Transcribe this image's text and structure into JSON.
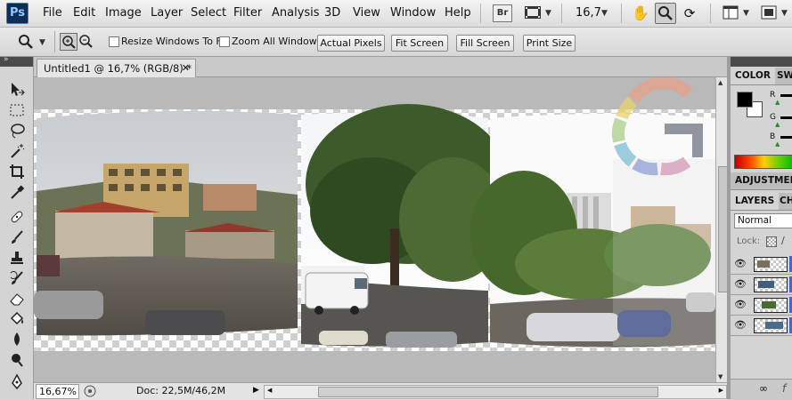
{
  "menubar": {
    "logo": "Ps",
    "items": [
      "File",
      "Edit",
      "Image",
      "Layer",
      "Select",
      "Filter",
      "Analysis",
      "3D",
      "View",
      "Window",
      "Help"
    ],
    "bridge_label": "Br",
    "zoom": "16,7"
  },
  "options": {
    "resize_windows_label": "Resize Windows To Fit",
    "zoom_all_windows_label": "Zoom All Windows",
    "actual_pixels": "Actual Pixels",
    "fit_screen": "Fit Screen",
    "fill_screen": "Fill Screen",
    "print_size": "Print Size"
  },
  "document": {
    "tab_title": "Untitled1 @ 16,7% (RGB/8) *",
    "zoom_status": "16,67%",
    "doc_info": "Doc: 22,5M/46,2M"
  },
  "panels": {
    "color_tab": "COLOR",
    "swatches_tab": "SW",
    "r_label": "R",
    "g_label": "G",
    "b_label": "B",
    "adjustments_tab": "ADJUSTMEN",
    "layers_tab": "LAYERS",
    "channels_tab": "CH",
    "blend_mode": "Normal",
    "lock_label": "Lock:",
    "layer_count": 4
  },
  "colors": {
    "foreground": "#000000",
    "background": "#ffffff",
    "selection": "#3a6ad6"
  },
  "icons": {
    "tools": [
      "move-tool-icon",
      "marquee-tool-icon",
      "lasso-tool-icon",
      "magic-wand-icon",
      "crop-tool-icon",
      "eyedropper-icon",
      "healing-brush-icon",
      "brush-tool-icon",
      "clone-stamp-icon",
      "history-brush-icon",
      "eraser-icon",
      "paint-bucket-icon",
      "blur-tool-icon",
      "dodge-tool-icon",
      "pen-tool-icon"
    ]
  }
}
